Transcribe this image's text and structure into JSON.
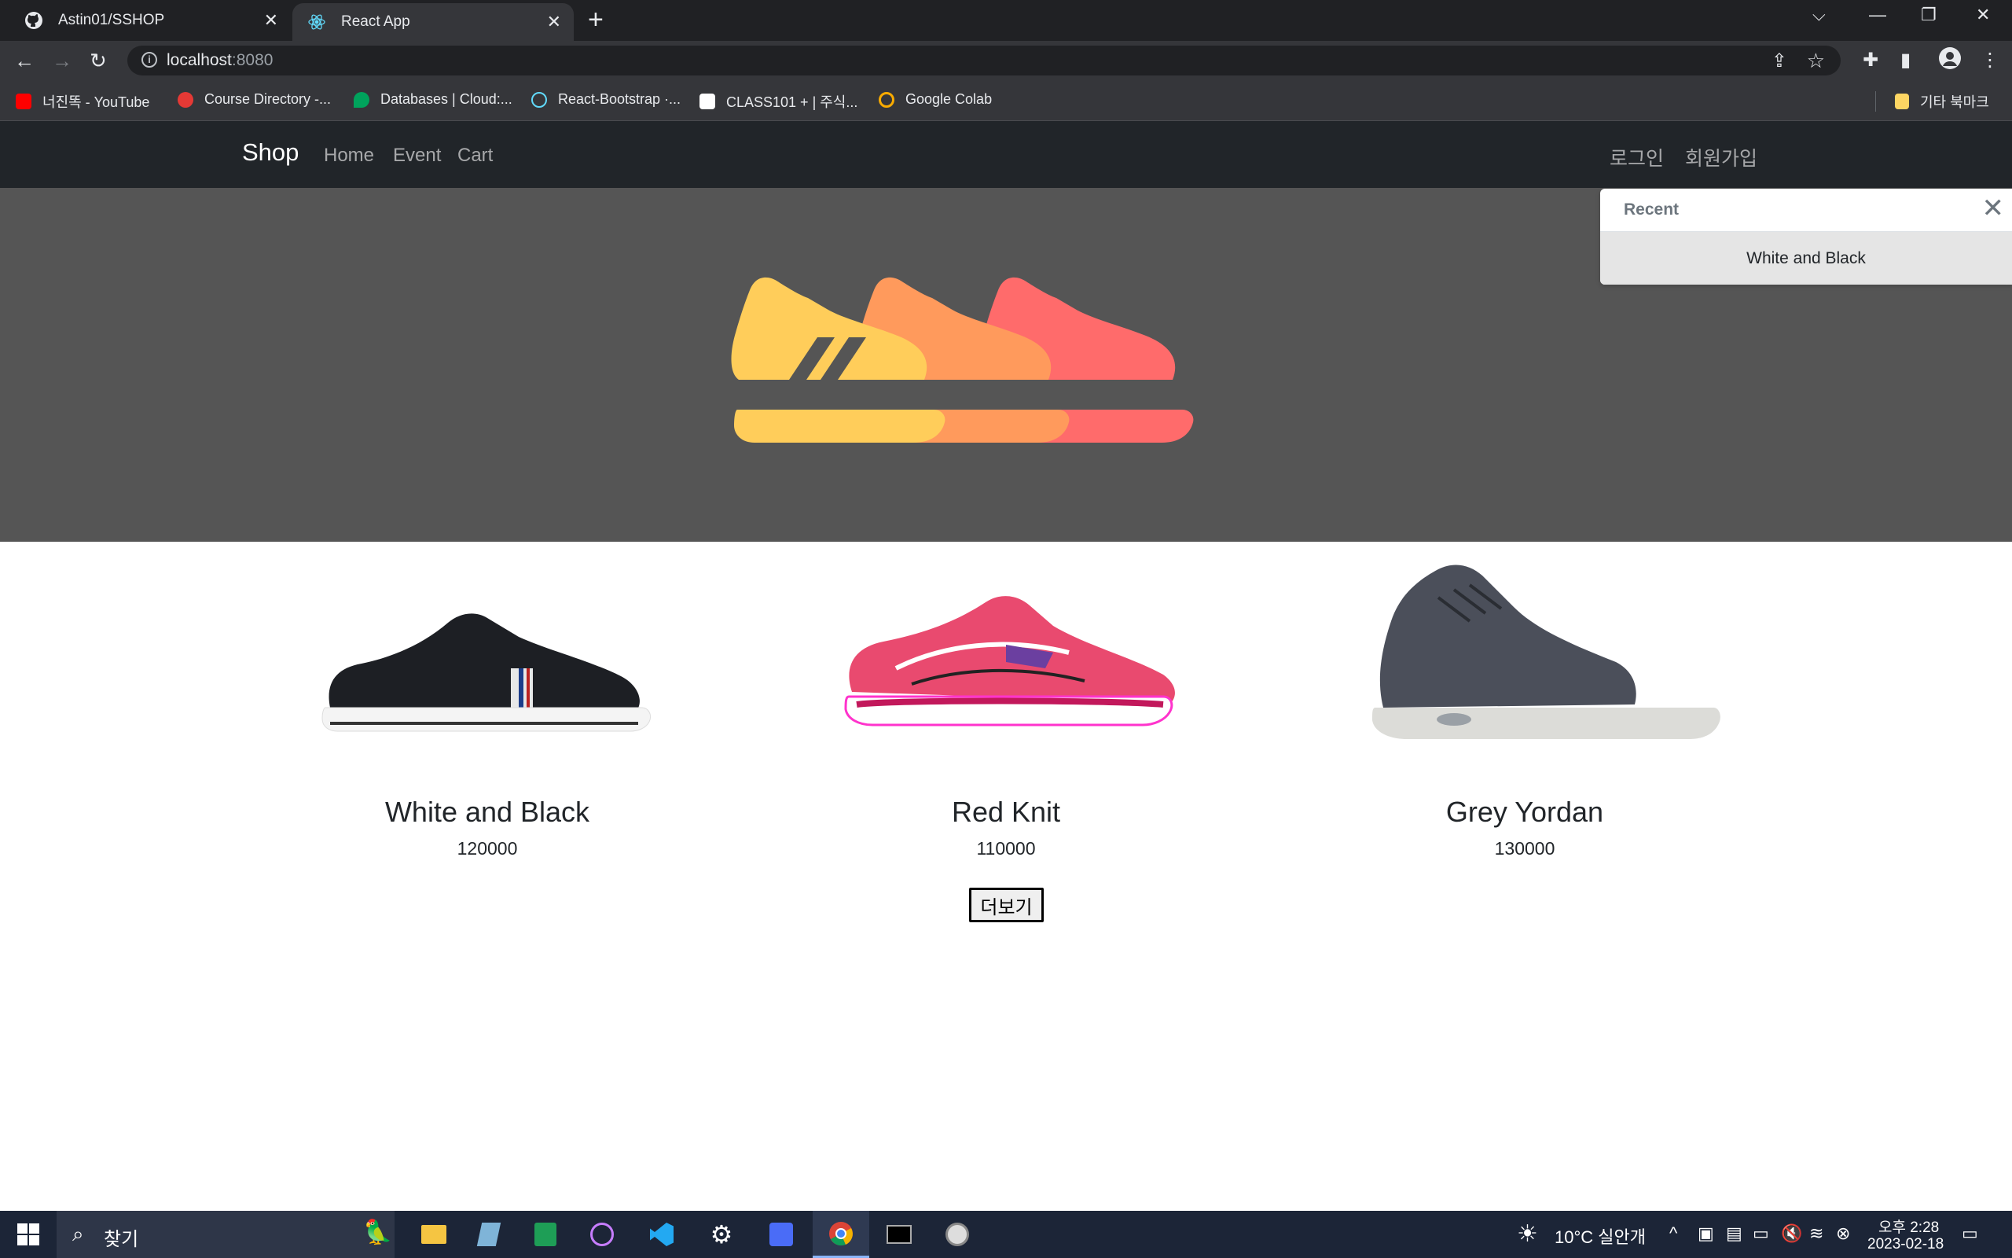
{
  "browser": {
    "tabs": [
      {
        "title": "Astin01/SSHOP",
        "icon": "github-icon"
      },
      {
        "title": "React App",
        "icon": "react-icon"
      }
    ],
    "close_glyph": "✕",
    "new_tab_glyph": "+",
    "address": {
      "host": "localhost",
      "port": ":8080"
    },
    "bookmarks": [
      {
        "label": "너진똑 - YouTube",
        "color": "#ff0000"
      },
      {
        "label": "Course Directory -...",
        "color": "#e53935"
      },
      {
        "label": "Databases | Cloud:...",
        "color": "#00a35c"
      },
      {
        "label": "React-Bootstrap ·...",
        "color": "#61dafb"
      },
      {
        "label": "CLASS101 + | 주식...",
        "color": "#ffffff"
      },
      {
        "label": "Google Colab",
        "color": "#f9ab00"
      }
    ],
    "other_bookmarks": "기타 북마크"
  },
  "navbar": {
    "brand": "Shop",
    "links": [
      "Home",
      "Event",
      "Cart"
    ],
    "login": "로그인",
    "signup": "회원가입"
  },
  "recent": {
    "title": "Recent",
    "close_glyph": "✕",
    "items": [
      "White and Black"
    ]
  },
  "products": [
    {
      "name": "White and Black",
      "price": "120000"
    },
    {
      "name": "Red Knit",
      "price": "110000"
    },
    {
      "name": "Grey Yordan",
      "price": "130000"
    }
  ],
  "more_button": "더보기",
  "taskbar": {
    "search_placeholder": "찾기",
    "weather": "10°C 실안개",
    "time": "오후 2:28",
    "date": "2023-02-18"
  },
  "colors": {
    "navbar_bg": "#212529",
    "hero_bg": "#555555",
    "shoe_yellow": "#ffcd5a",
    "shoe_orange": "#ff9a5c",
    "shoe_red": "#ff6b6b"
  }
}
